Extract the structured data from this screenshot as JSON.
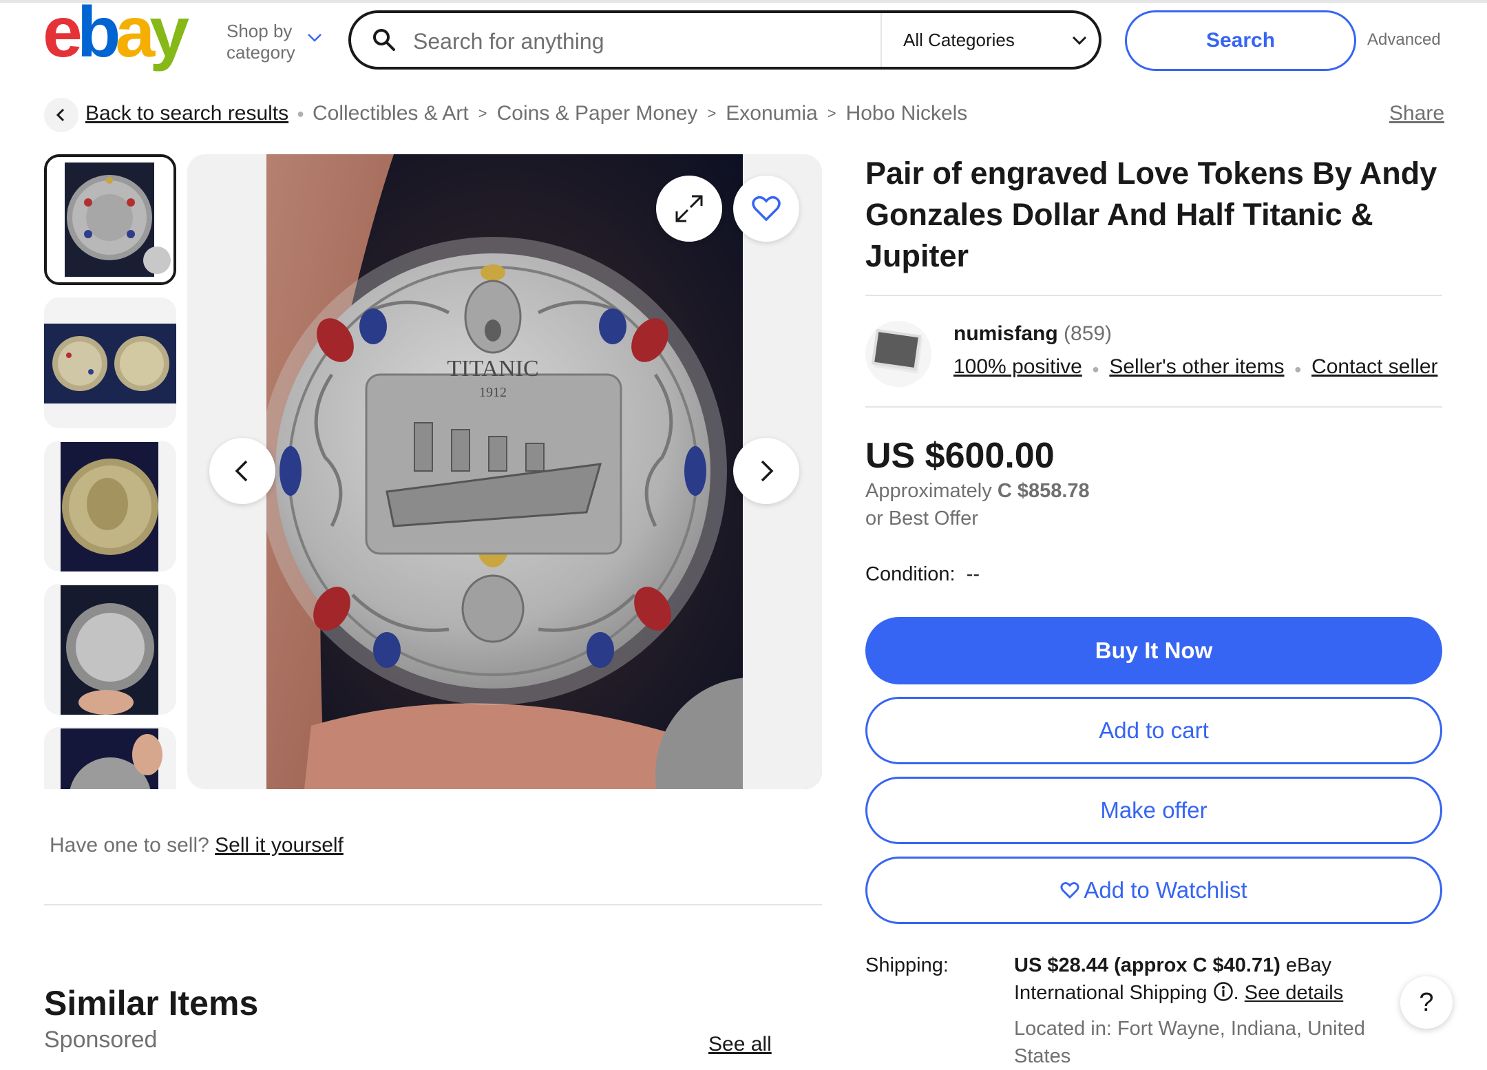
{
  "header": {
    "logo_text": "ebay",
    "logo_colors": [
      "#e53238",
      "#0064d2",
      "#f5af02",
      "#86b817"
    ],
    "shop_by_line1": "Shop by",
    "shop_by_line2": "category",
    "search_placeholder": "Search for anything",
    "category_selected": "All Categories",
    "search_button": "Search",
    "advanced": "Advanced"
  },
  "breadcrumb": {
    "back": "Back to search results",
    "items": [
      "Collectibles & Art",
      "Coins & Paper Money",
      "Exonumia",
      "Hobo Nickels"
    ],
    "share": "Share"
  },
  "gallery": {
    "thumbnail_count_visible": 5,
    "active_thumbnail": 1,
    "main_coin_text": "TITANIC",
    "main_coin_year": "1912"
  },
  "sell": {
    "prompt": "Have one to sell?",
    "link": "Sell it yourself"
  },
  "similar": {
    "title": "Similar Items",
    "sponsored": "Sponsored",
    "see_all": "See all"
  },
  "listing": {
    "title": "Pair of engraved Love Tokens By Andy Gonzales Dollar And Half Titanic & Jupiter",
    "seller": {
      "name": "numisfang",
      "feedback": "(859)",
      "positive": "100% positive",
      "other_items": "Seller's other items",
      "contact": "Contact seller"
    },
    "price": "US $600.00",
    "approx_label": "Approximately",
    "approx_value": "C $858.78",
    "best_offer": "or Best Offer",
    "condition_label": "Condition:",
    "condition_value": "--",
    "buttons": {
      "buy_now": "Buy It Now",
      "add_to_cart": "Add to cart",
      "make_offer": "Make offer",
      "watchlist": "Add to Watchlist"
    },
    "shipping": {
      "label": "Shipping:",
      "cost": "US $28.44 (approx C $40.71)",
      "service": "eBay International Shipping",
      "see_details": "See details",
      "located": "Located in: Fort Wayne, Indiana, United States"
    }
  },
  "help": "?",
  "colors": {
    "accent": "#3665f3",
    "text": "#191919",
    "muted": "#707070",
    "divider": "#e5e5e5"
  }
}
